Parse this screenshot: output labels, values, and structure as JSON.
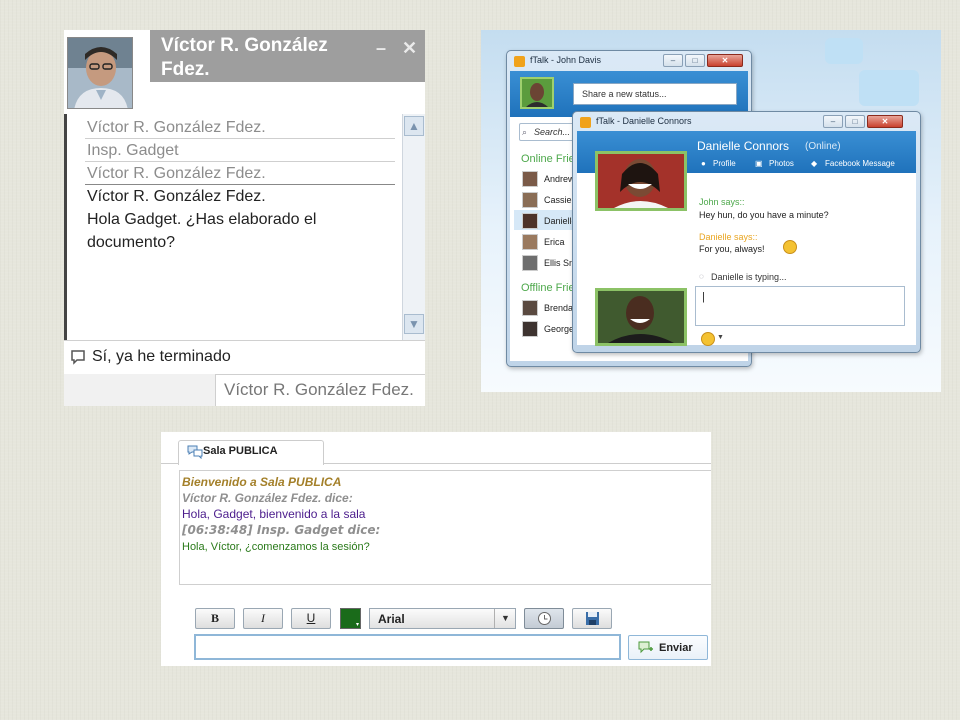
{
  "gadget_chat": {
    "contact_name": "Víctor R. González Fdez.",
    "controls": {
      "minimize": "–",
      "close": "✕"
    },
    "history": [
      {
        "text": "Víctor R. González Fdez.",
        "kind": "name"
      },
      {
        "text": "Insp. Gadget",
        "kind": "name"
      },
      {
        "text": "Víctor R. González Fdez.",
        "kind": "name"
      },
      {
        "text": "Víctor R. González Fdez.",
        "kind": "active-name"
      },
      {
        "text": "Hola Gadget. ¿Has elaborado el",
        "kind": "message"
      },
      {
        "text": "documento?",
        "kind": "message"
      }
    ],
    "input_value": "Sí, ya he terminado",
    "footer_status": "Víctor R. González Fdez."
  },
  "ftalk": {
    "main_window_title": "fTalk - John Davis",
    "status_placeholder": "Share a new status...",
    "search_placeholder": "Search...",
    "online_section": "Online Friends",
    "offline_section": "Offline Friends",
    "online_contacts": [
      "Andrew",
      "Cassie",
      "Danielle",
      "Erica",
      "Ellis Smith"
    ],
    "offline_contacts": [
      "Brenda",
      "George"
    ],
    "chat_window_title": "fTalk - Danielle Connors",
    "chat_contact": "Danielle Connors",
    "chat_status": "(Online)",
    "chat_links": [
      "Profile",
      "Photos",
      "Facebook Message"
    ],
    "messages": [
      {
        "who": "John says::",
        "text1": "Hey hun, do you have a minute?",
        "text2": ""
      },
      {
        "who": "Danielle says::",
        "text1": "For you, always!",
        "text2": ""
      }
    ],
    "typing": "Danielle is typing...",
    "composer_value": "|",
    "colors": {
      "accent": "#1f72bb",
      "green": "#4da84b"
    }
  },
  "sala": {
    "tab_label": "Sala PUBLICA",
    "messages": [
      {
        "text": "Bienvenido a Sala PUBLICA",
        "color": "#a4802a",
        "style": "bold-italic"
      },
      {
        "text": "Víctor R. González Fdez. dice:",
        "color": "#8f8f8f",
        "style": "bold-italic"
      },
      {
        "text": "Hola, Gadget, bienvenido a la sala",
        "color": "#4b1c8c",
        "style": "normal"
      },
      {
        "text": "[06:38:48] Insp. Gadget dice:",
        "color": "#8f8f8f",
        "style": "bold-italic"
      },
      {
        "text": "Hola, Víctor, ¿comenzamos la sesión?",
        "color": "#2a7a1a",
        "style": "small"
      }
    ],
    "toolbar": {
      "bold": "B",
      "italic": "I",
      "underline": "U",
      "font": "Arial",
      "font_color": "#1a6b1a"
    },
    "input_value": "",
    "send_label": "Enviar"
  }
}
